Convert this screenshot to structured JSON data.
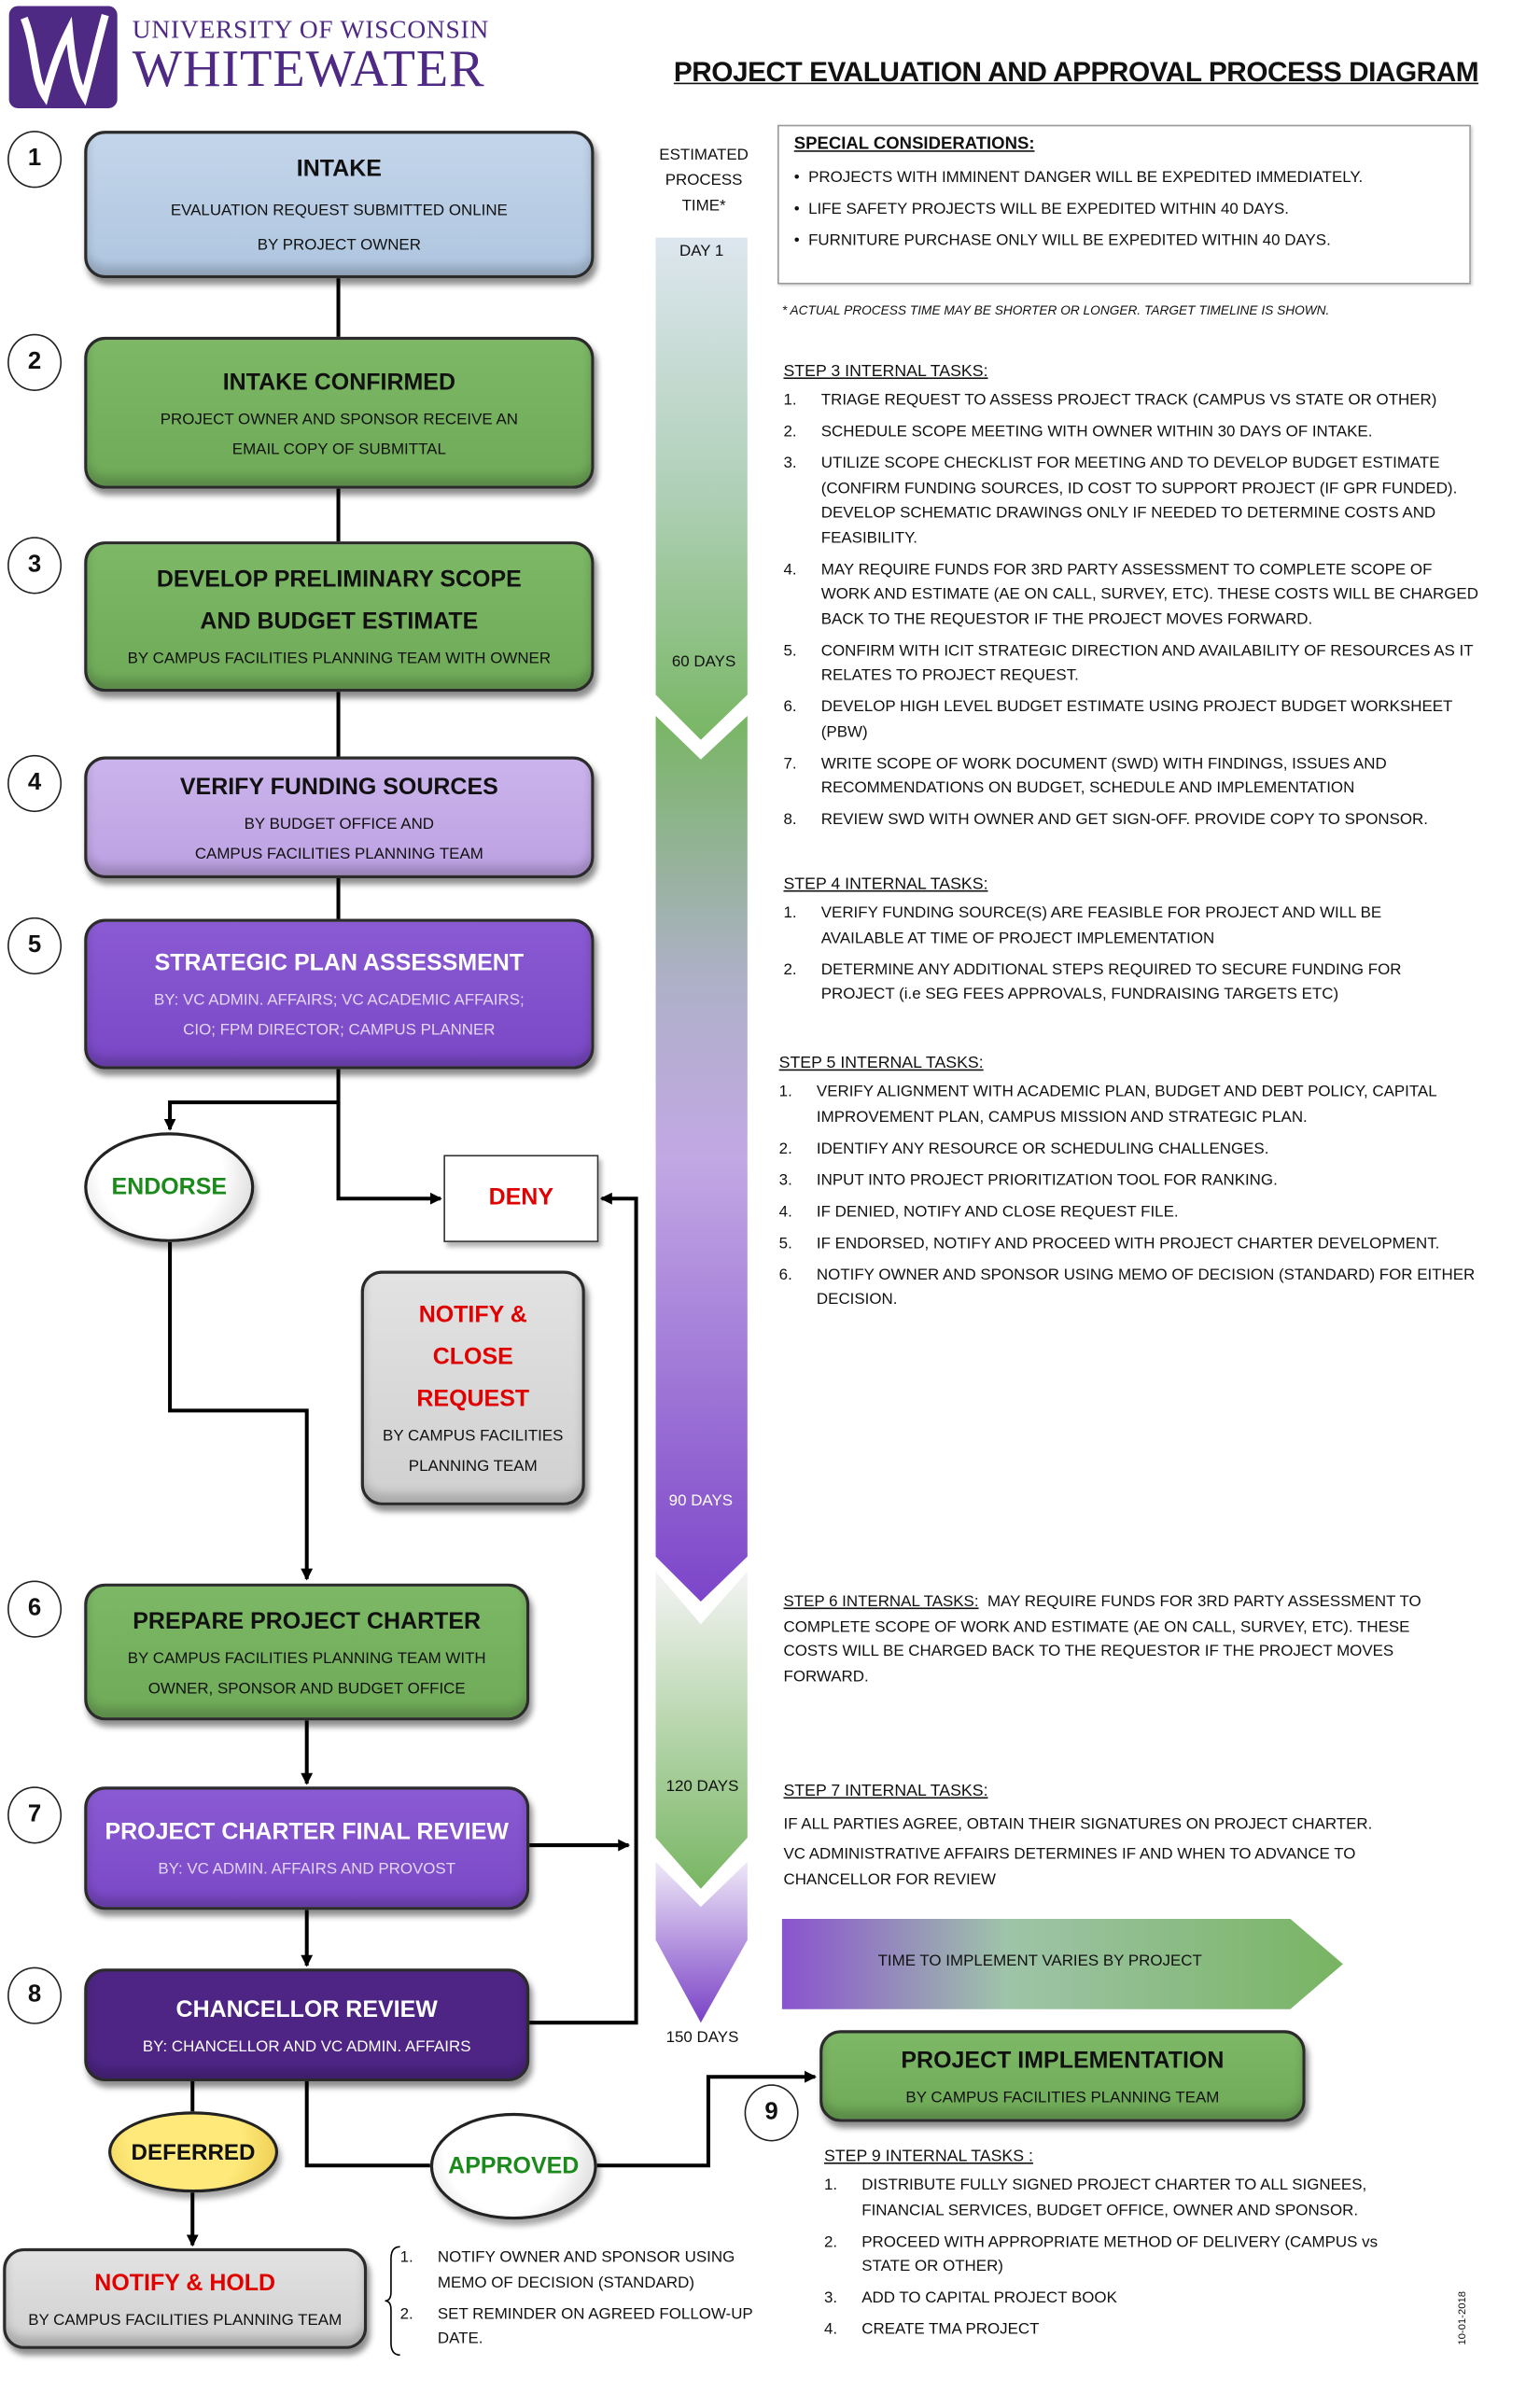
{
  "logo": {
    "line1": "UNIVERSITY OF WISCONSIN",
    "line2": "WHITEWATER",
    "color": "#4e2a84"
  },
  "title": "PROJECT EVALUATION AND APPROVAL PROCESS DIAGRAM",
  "timeline": {
    "heading": [
      "ESTIMATED",
      "PROCESS",
      "TIME*"
    ],
    "labels": [
      "DAY 1",
      "60 DAYS",
      "90 DAYS",
      "120 DAYS",
      "150 DAYS"
    ]
  },
  "special": {
    "heading": "SPECIAL CONSIDERATIONS:",
    "items": [
      "PROJECTS WITH IMMINENT DANGER WILL BE EXPEDITED IMMEDIATELY.",
      "LIFE SAFETY PROJECTS WILL BE EXPEDITED WITHIN 40 DAYS.",
      "FURNITURE PURCHASE ONLY WILL BE EXPEDITED WITHIN 40 DAYS."
    ],
    "footnote": "* ACTUAL PROCESS TIME MAY BE SHORTER OR LONGER. TARGET TIMELINE  IS SHOWN."
  },
  "steps": [
    {
      "num": "1",
      "title": "INTAKE",
      "lines": [
        "EVALUATION REQUEST SUBMITTED ONLINE",
        "BY PROJECT OWNER"
      ],
      "color": "#b8cce4"
    },
    {
      "num": "2",
      "title": "INTAKE CONFIRMED",
      "lines": [
        "PROJECT OWNER AND SPONSOR RECEIVE AN",
        "EMAIL COPY OF SUBMITTAL"
      ],
      "color": "#77b45f"
    },
    {
      "num": "3",
      "title": "DEVELOP PRELIMINARY SCOPE",
      "title2": "AND BUDGET ESTIMATE",
      "lines": [
        "BY CAMPUS FACILITIES PLANNING TEAM WITH OWNER"
      ],
      "color": "#77b45f"
    },
    {
      "num": "4",
      "title": "VERIFY FUNDING SOURCES",
      "lines": [
        "BY BUDGET OFFICE AND",
        "CAMPUS FACILITIES PLANNING TEAM"
      ],
      "color": "#c3a9e6"
    },
    {
      "num": "5",
      "title": "STRATEGIC PLAN ASSESSMENT",
      "lines": [
        "BY: VC ADMIN. AFFAIRS; VC ACADEMIC AFFAIRS;",
        "CIO; FPM DIRECTOR; CAMPUS PLANNER"
      ],
      "color": "#8050cc"
    },
    {
      "num": "6",
      "title": "PREPARE PROJECT CHARTER",
      "lines": [
        "BY CAMPUS FACILITIES PLANNING TEAM WITH",
        "OWNER, SPONSOR AND BUDGET OFFICE"
      ],
      "color": "#77b45f"
    },
    {
      "num": "7",
      "title": "PROJECT CHARTER FINAL REVIEW",
      "lines": [
        "BY: VC ADMIN. AFFAIRS AND PROVOST"
      ],
      "color": "#8050cc"
    },
    {
      "num": "8",
      "title": "CHANCELLOR REVIEW",
      "lines": [
        "BY: CHANCELLOR AND VC ADMIN. AFFAIRS"
      ],
      "color": "#4e2585"
    },
    {
      "num": "9",
      "title": "PROJECT IMPLEMENTATION",
      "lines": [
        "BY CAMPUS FACILITIES PLANNING TEAM"
      ],
      "color": "#77b45f"
    }
  ],
  "decisions": {
    "endorse": "ENDORSE",
    "deny": "DENY",
    "deferred": "DEFERRED",
    "approved": "APPROVED",
    "notify_close": {
      "title": [
        "NOTIFY &",
        "CLOSE",
        "REQUEST"
      ],
      "sub": [
        "BY CAMPUS FACILITIES",
        "PLANNING TEAM"
      ]
    },
    "notify_hold": {
      "title": "NOTIFY & HOLD",
      "sub": "BY CAMPUS FACILITIES PLANNING TEAM"
    },
    "hold_tasks": [
      "NOTIFY OWNER AND SPONSOR USING MEMO OF DECISION (STANDARD)",
      "SET REMINDER ON AGREED FOLLOW-UP DATE."
    ]
  },
  "tasks": {
    "step3": {
      "heading": "STEP 3 INTERNAL TASKS:",
      "items": [
        "TRIAGE REQUEST TO ASSESS PROJECT TRACK (CAMPUS VS STATE OR OTHER)",
        "SCHEDULE SCOPE MEETING WITH OWNER WITHIN 30 DAYS OF INTAKE.",
        "UTILIZE SCOPE CHECKLIST FOR MEETING AND TO DEVELOP BUDGET ESTIMATE (CONFIRM FUNDING SOURCES, ID COST TO SUPPORT PROJECT (IF GPR FUNDED).  DEVELOP SCHEMATIC DRAWINGS ONLY IF NEEDED TO DETERMINE COSTS AND FEASIBILITY.",
        "MAY REQUIRE FUNDS FOR 3RD PARTY ASSESSMENT TO COMPLETE SCOPE OF WORK AND ESTIMATE (AE ON CALL, SURVEY, ETC). THESE COSTS WILL BE CHARGED BACK TO THE REQUESTOR IF THE PROJECT MOVES FORWARD.",
        "CONFIRM WITH ICIT STRATEGIC DIRECTION AND AVAILABILITY OF RESOURCES AS IT RELATES TO PROJECT REQUEST.",
        "DEVELOP HIGH LEVEL BUDGET ESTIMATE USING PROJECT BUDGET WORKSHEET (PBW)",
        "WRITE SCOPE OF WORK DOCUMENT  (SWD) WITH FINDINGS, ISSUES AND RECOMMENDATIONS ON BUDGET, SCHEDULE AND IMPLEMENTATION",
        "REVIEW SWD WITH OWNER AND GET SIGN-OFF. PROVIDE COPY TO SPONSOR."
      ]
    },
    "step4": {
      "heading": "STEP 4 INTERNAL TASKS:",
      "items": [
        "VERIFY FUNDING SOURCE(S) ARE FEASIBLE FOR PROJECT AND WILL BE AVAILABLE AT TIME OF PROJECT IMPLEMENTATION",
        "DETERMINE ANY ADDITIONAL STEPS REQUIRED TO SECURE FUNDING FOR PROJECT (i.e SEG FEES APPROVALS, FUNDRAISING TARGETS ETC)"
      ]
    },
    "step5": {
      "heading": "STEP 5 INTERNAL TASKS:",
      "items": [
        "VERIFY ALIGNMENT WITH ACADEMIC PLAN, BUDGET AND DEBT POLICY, CAPITAL IMPROVEMENT PLAN, CAMPUS MISSION AND STRATEGIC PLAN.",
        "IDENTIFY ANY RESOURCE OR SCHEDULING CHALLENGES.",
        "INPUT INTO PROJECT PRIORITIZATION TOOL FOR RANKING.",
        "IF DENIED, NOTIFY AND CLOSE REQUEST FILE.",
        "IF ENDORSED, NOTIFY AND PROCEED WITH PROJECT CHARTER DEVELOPMENT.",
        "NOTIFY OWNER AND SPONSOR USING MEMO OF DECISION (STANDARD) FOR EITHER DECISION."
      ]
    },
    "step6": {
      "heading": "STEP 6 INTERNAL TASKS:",
      "text": "MAY REQUIRE FUNDS FOR 3RD PARTY ASSESSMENT TO COMPLETE SCOPE OF WORK AND ESTIMATE (AE ON CALL, SURVEY, ETC). THESE COSTS WILL BE CHARGED BACK TO THE REQUESTOR IF THE PROJECT MOVES FORWARD."
    },
    "step7": {
      "heading": "STEP 7 INTERNAL TASKS:",
      "lines": [
        "IF ALL PARTIES AGREE, OBTAIN THEIR SIGNATURES ON PROJECT CHARTER.",
        "VC ADMINISTRATIVE  AFFAIRS DETERMINES IF AND WHEN TO ADVANCE TO CHANCELLOR  FOR REVIEW"
      ]
    },
    "step9": {
      "heading": "STEP 9 INTERNAL TASKS :",
      "items": [
        "DISTRIBUTE FULLY SIGNED PROJECT CHARTER TO ALL SIGNEES, FINANCIAL SERVICES, BUDGET OFFICE, OWNER AND SPONSOR.",
        "PROCEED WITH APPROPRIATE METHOD OF DELIVERY (CAMPUS vs STATE OR OTHER)",
        "ADD TO CAPITAL PROJECT BOOK",
        "CREATE TMA PROJECT"
      ]
    }
  },
  "banner": "TIME TO IMPLEMENT VARIES BY PROJECT",
  "date": "10-01-2018"
}
